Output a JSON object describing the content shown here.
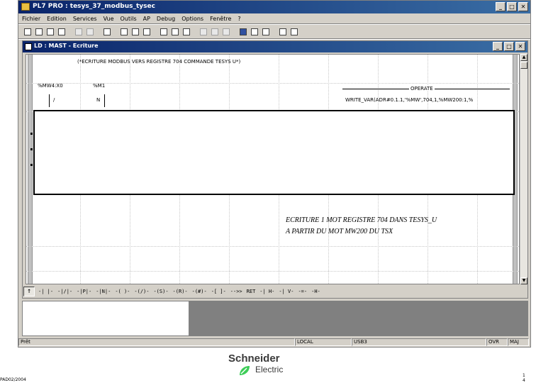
{
  "app": {
    "title": "PL7 PRO : tesys_37_modbus_tysec",
    "controls": {
      "minimize": "_",
      "maximize": "□",
      "close": "✕"
    }
  },
  "menu": [
    "Fichier",
    "Edition",
    "Services",
    "Vue",
    "Outils",
    "AP",
    "Debug",
    "Options",
    "Fenêtre",
    "?"
  ],
  "ld_window": {
    "title": "LD : MAST - Ecriture",
    "comment": "(*ECRITURE MODBUS VERS REGISTRE 704 COMMANDE TESYS U*)",
    "contact1_label": "%MW4:X0",
    "contact2_label": "%M1",
    "contact1_symbol": "/",
    "contact2_symbol": "N",
    "operate_label": "OPERATE",
    "operate_text": "WRITE_VAR(ADR#0.1.1,'%MW',704,1,%MW200:1,%",
    "vscroll_up": "▲",
    "vscroll_down": "▼"
  },
  "annotation": {
    "line1": "ECRITURE 1 MOT REGISTRE 704 DANS TESYS_U",
    "line2": "A PARTIR DU MOT MW200 DU TSX"
  },
  "ld_toolbar": {
    "first": "↑",
    "items": [
      "-| |-",
      "-|/|-",
      "-|P|-",
      "-|N|-",
      "-( )-",
      "-(/)-",
      "-(S)-",
      "-(R)-",
      "-(#)-",
      "-[ ]-",
      "-->>",
      "RET",
      "-| H-",
      "-| V-",
      "-=-",
      "-H-"
    ]
  },
  "status_bar": {
    "left": "Prêt",
    "mid1": "LOCAL",
    "mid2": "USB3",
    "right1": "OVR",
    "right2": "MAJ"
  },
  "footer": {
    "doc_ref": "PAD02/2004",
    "page_number": "1\n4",
    "brand_line1": "Schneider",
    "brand_line2": "Electric"
  },
  "colors": {
    "titlebar_start": "#0a246a",
    "titlebar_end": "#3a6ea5",
    "logo_green": "#3dcd58"
  }
}
